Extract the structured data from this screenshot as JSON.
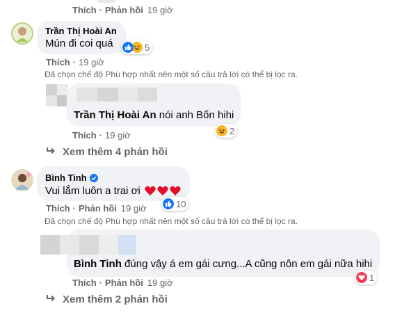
{
  "top": {
    "like": "Thích",
    "reply": "Phản hồi",
    "time": "19 giờ"
  },
  "comment1": {
    "author": "Trần Thị Hoài An",
    "text": "Mún đi coi quá",
    "reactions": "5",
    "like": "Thích",
    "time": "19 giờ",
    "filter_note": "Đã chọn chế độ Phù hợp nhất nên một số câu trả lời có thể bị lọc ra."
  },
  "reply1": {
    "mention": "Trần Thị Hoài An",
    "text": " nói anh Bốn hihi",
    "reactions": "2",
    "like": "Thích",
    "time": "19 giờ"
  },
  "more1": "Xem thêm 4 phản hồi",
  "comment2": {
    "author": "Bình Tinh",
    "text": "Vui lắm luôn a trai ơi",
    "reactions": "10",
    "like": "Thích",
    "reply": "Phản hồi",
    "time": "19 giờ",
    "filter_note": "Đã chọn chế độ Phù hợp nhất nên một số câu trả lời có thể bị lọc ra."
  },
  "reply2": {
    "mention": "Bình Tinh",
    "text": " đúng vậy á em gái cưng...A cũng nôn em gái nữa hihi",
    "reactions": "1",
    "like": "Thích",
    "reply": "Phản hồi",
    "time": "19 giờ"
  },
  "more2": "Xem thêm 2 phản hồi",
  "colors": {
    "like_blue": "#1877f2",
    "heart_red": "#f33e58",
    "haha_yellow": "#f7b928",
    "verified": "#1877f2"
  }
}
